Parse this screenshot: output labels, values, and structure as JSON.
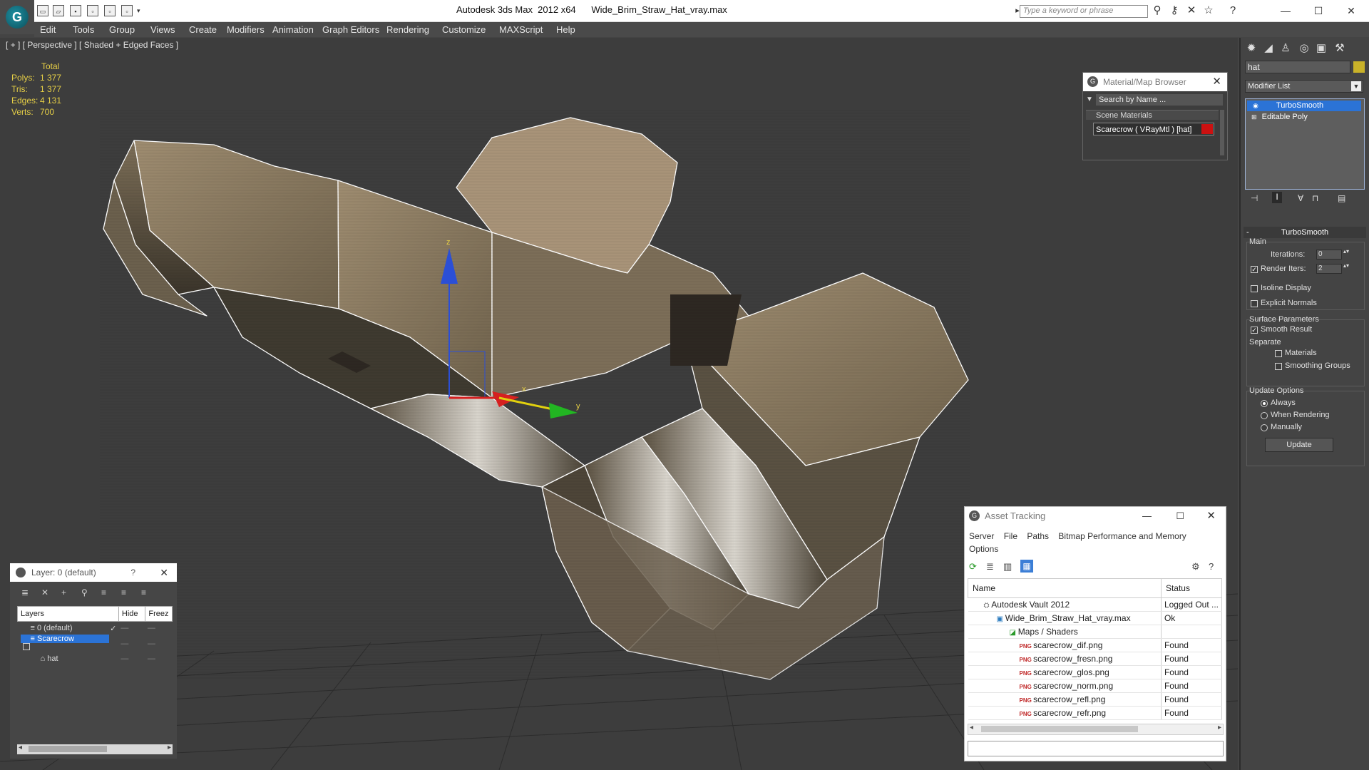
{
  "app": {
    "title": "Autodesk 3ds Max  2012 x64      Wide_Brim_Straw_Hat_vray.max",
    "search_placeholder": "Type a keyword or phrase",
    "logo": "G"
  },
  "menu": [
    "Edit",
    "Tools",
    "Group",
    "Views",
    "Create",
    "Modifiers",
    "Animation",
    "Graph Editors",
    "Rendering",
    "Customize",
    "MAXScript",
    "Help"
  ],
  "viewport": {
    "label": "[ + ] [ Perspective ] [ Shaded + Edged Faces ]",
    "stats": {
      "header": "Total",
      "rows": [
        {
          "label": "Polys:",
          "value": "1 377"
        },
        {
          "label": "Tris:",
          "value": "1 377"
        },
        {
          "label": "Edges:",
          "value": "4 131"
        },
        {
          "label": "Verts:",
          "value": "700"
        }
      ]
    },
    "gizmo": {
      "x_label": "x",
      "y_label": "y",
      "z_label": "z"
    }
  },
  "command_panel": {
    "object_name": "hat",
    "object_color": "#c9b229",
    "modifier_list": "Modifier List",
    "stack": [
      {
        "label": "TurboSmooth",
        "selected": true
      },
      {
        "label": "Editable Poly",
        "selected": false
      }
    ],
    "turbosmooth": {
      "title": "TurboSmooth",
      "main_label": "Main",
      "iterations_label": "Iterations:",
      "iterations_value": "0",
      "render_iters_label": "Render Iters:",
      "render_iters_value": "2",
      "isoline": "Isoline Display",
      "explicit_normals": "Explicit Normals",
      "surface_params": "Surface Parameters",
      "smooth_result": "Smooth Result",
      "separate": "Separate",
      "materials": "Materials",
      "smoothing_groups": "Smoothing Groups",
      "update_options": "Update Options",
      "always": "Always",
      "when_rendering": "When Rendering",
      "manually": "Manually",
      "update_btn": "Update"
    }
  },
  "material_browser": {
    "title": "Material/Map Browser",
    "search": "Search by Name ...",
    "section": "Scene Materials",
    "material": "Scarecrow  ( VRayMtl ) [hat]",
    "material_color": "#cc1111"
  },
  "asset_tracking": {
    "title": "Asset Tracking",
    "menu": [
      "Server",
      "File",
      "Paths",
      "Bitmap Performance and Memory",
      "Options"
    ],
    "columns": [
      "Name",
      "Status"
    ],
    "rows": [
      {
        "name": "Autodesk Vault 2012",
        "status": "Logged Out ...",
        "indent": 1,
        "icon": "vault"
      },
      {
        "name": "Wide_Brim_Straw_Hat_vray.max",
        "status": "Ok",
        "indent": 2,
        "icon": "max"
      },
      {
        "name": "Maps / Shaders",
        "status": "",
        "indent": 3,
        "icon": "maps"
      },
      {
        "name": "scarecrow_dif.png",
        "status": "Found",
        "indent": 4,
        "icon": "png"
      },
      {
        "name": "scarecrow_fresn.png",
        "status": "Found",
        "indent": 4,
        "icon": "png"
      },
      {
        "name": "scarecrow_glos.png",
        "status": "Found",
        "indent": 4,
        "icon": "png"
      },
      {
        "name": "scarecrow_norm.png",
        "status": "Found",
        "indent": 4,
        "icon": "png"
      },
      {
        "name": "scarecrow_refl.png",
        "status": "Found",
        "indent": 4,
        "icon": "png"
      },
      {
        "name": "scarecrow_refr.png",
        "status": "Found",
        "indent": 4,
        "icon": "png"
      }
    ]
  },
  "layer_window": {
    "title": "Layer: 0 (default)",
    "help": "?",
    "columns": [
      "Layers",
      "Hide",
      "Freez"
    ],
    "rows": [
      {
        "name": "0 (default)",
        "selected": false
      },
      {
        "name": "Scarecrow",
        "selected": true
      },
      {
        "name": "hat",
        "selected": false
      }
    ]
  }
}
